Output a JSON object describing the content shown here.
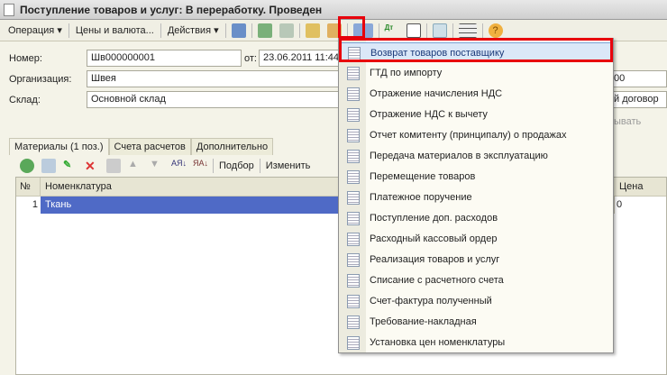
{
  "window": {
    "title": "Поступление товаров и услуг: В переработку. Проведен"
  },
  "toolbar": {
    "operation": "Операция ▾",
    "prices": "Цены и валюта...",
    "actions": "Действия ▾"
  },
  "form": {
    "number_label": "Номер:",
    "number_value": "Шв000000001",
    "date_label": "от:",
    "date_value": "23.06.2011 11:44",
    "org_label": "Организация:",
    "org_value": "Швея",
    "warehouse_label": "Склад:",
    "warehouse_value": "Основной склад",
    "right_partial_1": "00",
    "right_partial_2": "й договор",
    "right_partial_3": "ывать"
  },
  "tabs": [
    "Материалы (1 поз.)",
    "Счета расчетов",
    "Дополнительно"
  ],
  "grid_toolbar": {
    "pick": "Подбор",
    "change": "Изменить"
  },
  "grid": {
    "columns": [
      "№",
      "Номенклатура",
      "Цена"
    ],
    "rows": [
      {
        "n": "1",
        "item": "Ткань",
        "partial": "0"
      }
    ]
  },
  "menu": {
    "items": [
      "Возврат товаров поставщику",
      "ГТД по импорту",
      "Отражение начисления НДС",
      "Отражение НДС к вычету",
      "Отчет комитенту (принципалу) о продажах",
      "Передача материалов в эксплуатацию",
      "Перемещение товаров",
      "Платежное поручение",
      "Поступление доп. расходов",
      "Расходный кассовый ордер",
      "Реализация товаров и услуг",
      "Списание с расчетного счета",
      "Счет-фактура полученный",
      "Требование-накладная",
      "Установка цен номенклатуры"
    ]
  },
  "colors": {
    "highlight": "#e8000b",
    "selected_row": "#4f6ac6"
  }
}
